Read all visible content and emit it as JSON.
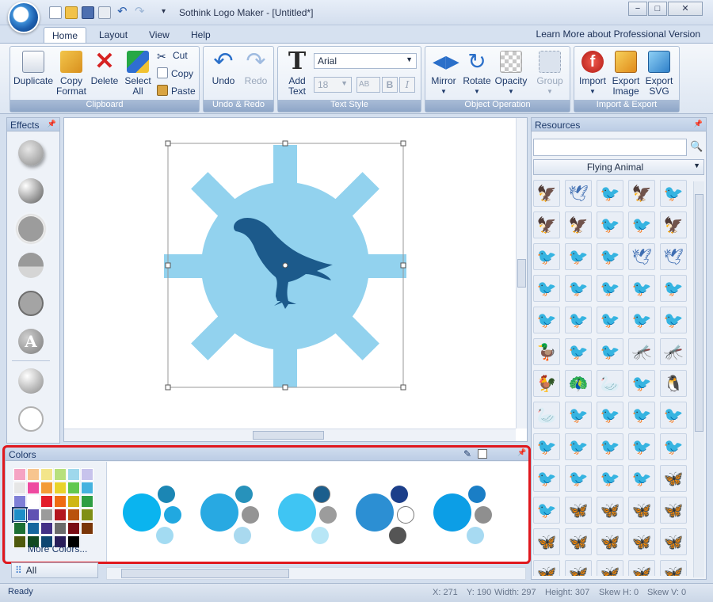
{
  "app": {
    "title": "Sothink Logo Maker - [Untitled*]",
    "window_controls": [
      "−",
      "□",
      "✕"
    ]
  },
  "tabs": [
    {
      "label": "Home",
      "active": true
    },
    {
      "label": "Layout",
      "active": false
    },
    {
      "label": "View",
      "active": false
    },
    {
      "label": "Help",
      "active": false
    }
  ],
  "learn_more": "Learn More about Professional Version",
  "ribbon": {
    "clipboard": {
      "label": "Clipboard",
      "duplicate": "Duplicate",
      "copy_format_1": "Copy",
      "copy_format_2": "Format",
      "delete": "Delete",
      "select_all_1": "Select",
      "select_all_2": "All",
      "cut": "Cut",
      "copy": "Copy",
      "paste": "Paste"
    },
    "undo_redo": {
      "label": "Undo & Redo",
      "undo": "Undo",
      "redo": "Redo"
    },
    "text_style": {
      "label": "Text Style",
      "add_text_1": "Add",
      "add_text_2": "Text",
      "font": "Arial",
      "size": "18",
      "bold": "B",
      "italic": "I",
      "ab": "AB"
    },
    "object_operation": {
      "label": "Object Operation",
      "mirror": "Mirror",
      "rotate": "Rotate",
      "opacity": "Opacity",
      "group": "Group"
    },
    "import_export": {
      "label": "Import & Export",
      "import": "Import",
      "export_image_1": "Export",
      "export_image_2": "Image",
      "export_svg_1": "Export",
      "export_svg_2": "SVG"
    }
  },
  "effects": {
    "title": "Effects",
    "text_effect_letter": "A"
  },
  "resources": {
    "title": "Resources",
    "search_placeholder": "",
    "category": "Flying Animal"
  },
  "colors": {
    "title": "Colors",
    "more_colors": "More Colors...",
    "filter": "All"
  },
  "palette": [
    "#f5a3c3",
    "#f7c58f",
    "#f3e58a",
    "#b7e07c",
    "#9fd8ec",
    "#c7c3ec",
    "#e6e6e6",
    "#ee4aa0",
    "#f39b37",
    "#e8d32c",
    "#62c84e",
    "#45b2df",
    "#7f7fd6",
    "#ffffff",
    "#e31d2b",
    "#ef6c12",
    "#cfb613",
    "#2e9e43",
    "#1d8ec7",
    "#6052b3",
    "#9b9b9b",
    "#b3151f",
    "#b9520d",
    "#7f8f16",
    "#1d7034",
    "#16679e",
    "#433086",
    "#6b6b6b",
    "#7a0d15",
    "#7a3608",
    "#4f5a0d",
    "#114a21",
    "#0e4571",
    "#2a1e5a",
    "#000000"
  ],
  "color_schemes": [
    {
      "big": "#0ab4ef",
      "c1": "#1b86b4",
      "c2": "#21a8e0",
      "c3": "#a3dbf2"
    },
    {
      "big": "#28a9e2",
      "c1": "#2792bb",
      "c2": "#949494",
      "c3": "#a9d9ef"
    },
    {
      "big": "#3fc5f3",
      "c1": "#1b5e8d",
      "c2": "#9c9c9c",
      "c3": "#b7e6f6"
    },
    {
      "big": "#2c8fd3",
      "c1": "#1c3f8a",
      "c2": "#ffffff",
      "c3": "#555555"
    },
    {
      "big": "#0c9ee6",
      "c1": "#1a7ec6",
      "c2": "#8f8f8f",
      "c3": "#a7daf2"
    }
  ],
  "canvas": {
    "fill_light": "#92d2ee",
    "fill_dark": "#1c5a8b"
  },
  "status": {
    "ready": "Ready",
    "x": "X: 271",
    "y": "Y: 190",
    "width": "Width: 297",
    "height": "Height: 307",
    "skew_h": "Skew H: 0",
    "skew_v": "Skew V: 0"
  },
  "animal_icons": [
    "🦅",
    "🕊",
    "🐦",
    "🦅",
    "🐦",
    "🦅",
    "🦅",
    "🐦",
    "🐦",
    "🦅",
    "🐦",
    "🐦",
    "🐦",
    "🕊",
    "🕊",
    "🐦",
    "🐦",
    "🐦",
    "🐦",
    "🐦",
    "🐦",
    "🐦",
    "🐦",
    "🐦",
    "🐦",
    "🦆",
    "🐦",
    "🐦",
    "🦟",
    "🦟",
    "🐓",
    "🦚",
    "🦢",
    "🐦",
    "🐧",
    "🦢",
    "🐦",
    "🐦",
    "🐦",
    "🐦",
    "🐦",
    "🐦",
    "🐦",
    "🐦",
    "🐦",
    "🐦",
    "🐦",
    "🐦",
    "🐦",
    "🦋",
    "🐦",
    "🦋",
    "🦋",
    "🦋",
    "🦋",
    "🦋",
    "🦋",
    "🦋",
    "🦋",
    "🦋",
    "🦋",
    "🦋",
    "🦋",
    "🦋",
    "🦋"
  ]
}
